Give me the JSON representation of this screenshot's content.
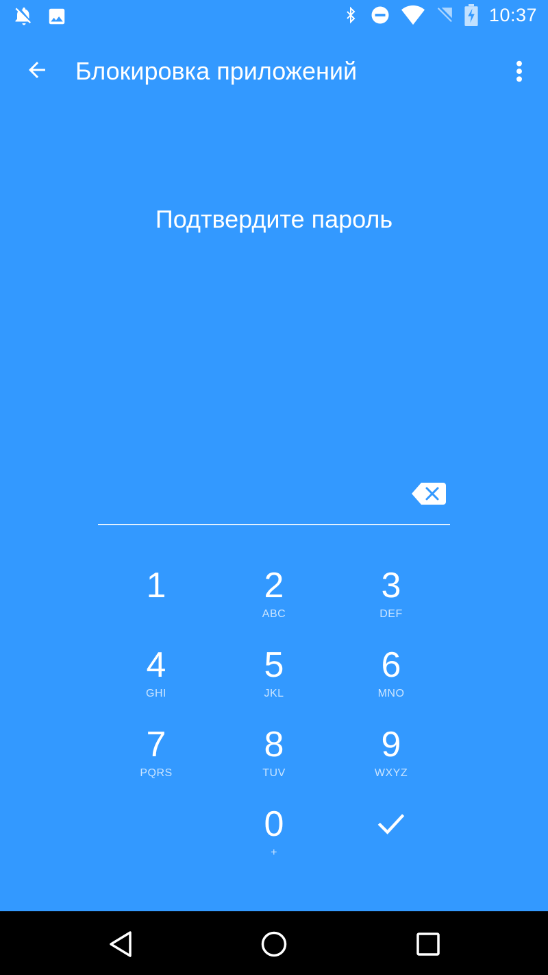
{
  "status_bar": {
    "time": "10:37",
    "icons_left": [
      "notifications-off-icon",
      "image-icon"
    ],
    "icons_right": [
      "bluetooth-icon",
      "do-not-disturb-icon",
      "wifi-icon",
      "no-sim-icon",
      "battery-charging-icon"
    ]
  },
  "app_bar": {
    "title": "Блокировка приложений",
    "back_icon": "arrow-back-icon",
    "menu_icon": "more-vert-icon"
  },
  "prompt": "Подтвердите пароль",
  "pin": {
    "value": "",
    "backspace_icon": "backspace-icon"
  },
  "keypad": {
    "keys": [
      {
        "digit": "1",
        "letters": ""
      },
      {
        "digit": "2",
        "letters": "ABC"
      },
      {
        "digit": "3",
        "letters": "DEF"
      },
      {
        "digit": "4",
        "letters": "GHI"
      },
      {
        "digit": "5",
        "letters": "JKL"
      },
      {
        "digit": "6",
        "letters": "MNO"
      },
      {
        "digit": "7",
        "letters": "PQRS"
      },
      {
        "digit": "8",
        "letters": "TUV"
      },
      {
        "digit": "9",
        "letters": "WXYZ"
      },
      {
        "digit": "0",
        "letters": "+"
      }
    ],
    "confirm_icon": "check-icon"
  },
  "nav_bar": {
    "icons": [
      "nav-back-icon",
      "nav-home-icon",
      "nav-recents-icon"
    ]
  },
  "colors": {
    "background": "#3399FF",
    "nav_bar": "#000000",
    "text": "#FFFFFF"
  }
}
